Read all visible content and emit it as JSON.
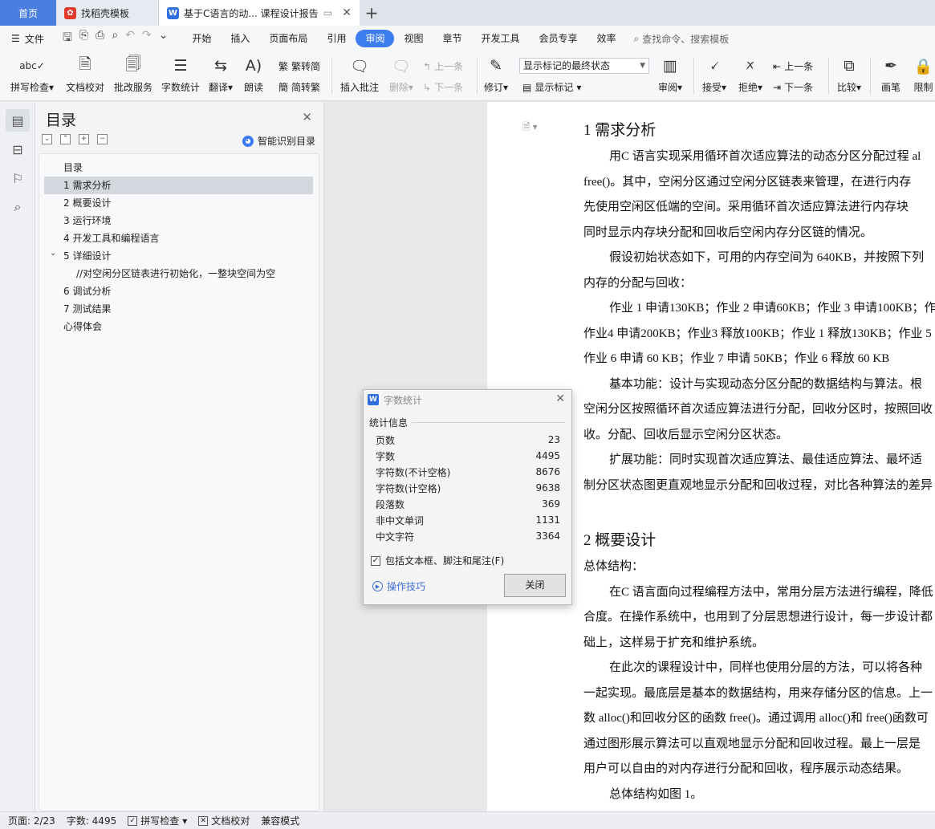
{
  "tabs": {
    "home": "首页",
    "template": "找稻壳模板",
    "doc": "基于C语言的动... 课程设计报告",
    "add": "+"
  },
  "menu": {
    "file": "文件",
    "items": [
      "开始",
      "插入",
      "页面布局",
      "引用",
      "审阅",
      "视图",
      "章节",
      "开发工具",
      "会员专享",
      "效率"
    ],
    "active": "审阅",
    "search": "查找命令、搜索模板"
  },
  "ribbon": {
    "spell": "拼写检查",
    "proof": "文档校对",
    "correct": "批改服务",
    "wordcount": "字数统计",
    "translate": "翻译",
    "read": "朗读",
    "to_simplified": "繁转简",
    "to_traditional": "简转繁",
    "insert_comment": "插入批注",
    "delete": "删除",
    "prev": "上一条",
    "next": "下一条",
    "revise": "修订",
    "markup_select": "显示标记的最终状态",
    "show_markup": "显示标记",
    "review": "审阅",
    "accept": "接受",
    "reject": "拒绝",
    "prev2": "上一条",
    "next2": "下一条",
    "compare": "比较",
    "pen": "画笔",
    "restrict": "限制"
  },
  "toc": {
    "title": "目录",
    "smart": "智能识别目录",
    "items": [
      "目录",
      "1 需求分析",
      "2 概要设计",
      "3 运行环境",
      "4 开发工具和编程语言",
      "5 详细设计",
      "//对空闲分区链表进行初始化，一整块空间为空",
      "6 调试分析",
      "7 测试结果",
      "心得体会"
    ]
  },
  "doc": {
    "h1": "1 需求分析",
    "h2": "2 概要设计",
    "lines": [
      "用C 语言实现采用循环首次适应算法的动态分区分配过程 al",
      "free()。其中，空闲分区通过空闲分区链表来管理，在进行内存",
      "先使用空闲区低端的空间。采用循环首次适应算法进行内存块",
      "同时显示内存块分配和回收后空闲内存分区链的情况。",
      "假设初始状态如下，可用的内存空间为 640KB，并按照下列",
      "内存的分配与回收：",
      "作业 1 申请130KB；作业 2 申请60KB；作业 3 申请100KB；作业",
      "作业4 申请200KB；作业3 释放100KB；作业 1 释放130KB；作业 5 申",
      "作业 6 申请 60 KB；作业 7 申请 50KB；作业 6 释放 60 KB",
      "基本功能：设计与实现动态分区分配的数据结构与算法。根",
      "空闲分区按照循环首次适应算法进行分配，回收分区时，按照回收",
      "收。分配、回收后显示空闲分区状态。",
      "扩展功能：同时实现首次适应算法、最佳适应算法、最坏适",
      "制分区状态图更直观地显示分配和回收过程，对比各种算法的差异"
    ],
    "lines2": [
      "总体结构：",
      "在C 语言面向过程编程方法中，常用分层方法进行编程，降低",
      "合度。在操作系统中，也用到了分层思想进行设计，每一步设计都",
      "础上，这样易于扩充和维护系统。",
      "在此次的课程设计中，同样也使用分层的方法，可以将各种",
      "一起实现。最底层是基本的数据结构，用来存储分区的信息。上一",
      "数 alloc()和回收分区的函数 free()。通过调用 alloc()和 free()函数可",
      "通过图形展示算法可以直观地显示分配和回收过程。最上一层是",
      "用户可以自由的对内存进行分配和回收，程序展示动态结果。",
      "总体结构如图 1。"
    ]
  },
  "dialog": {
    "title": "字数统计",
    "section": "统计信息",
    "rows": [
      {
        "label": "页数",
        "value": "23"
      },
      {
        "label": "字数",
        "value": "4495"
      },
      {
        "label": "字符数(不计空格)",
        "value": "8676"
      },
      {
        "label": "字符数(计空格)",
        "value": "9638"
      },
      {
        "label": "段落数",
        "value": "369"
      },
      {
        "label": "非中文单词",
        "value": "1131"
      },
      {
        "label": "中文字符",
        "value": "3364"
      }
    ],
    "checkbox": "包括文本框、脚注和尾注(F)",
    "checked": true,
    "tips": "操作技巧",
    "close": "关闭"
  },
  "status": {
    "page": "页面: 2/23",
    "words": "字数: 4495",
    "spell": "拼写检查",
    "proof": "文档校对",
    "compat": "兼容模式"
  },
  "colors": {
    "accent": "#3d7cf0",
    "home_tab": "#4a7fe0"
  }
}
